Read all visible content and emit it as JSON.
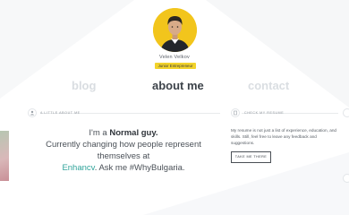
{
  "profile": {
    "name": "Velen Velkov",
    "tagline": "Junior Entrepreneur"
  },
  "nav": {
    "blog": "blog",
    "about": "about me",
    "contact": "contact"
  },
  "sections": {
    "about_label": "A LITTLE ABOUT ME",
    "resume_label": "CHECK MY RESUME"
  },
  "about": {
    "intro": "I'm a",
    "highlight": "Normal guy.",
    "line2": "Currently changing how people represent themselves at",
    "brand": "Enhancv",
    "line3": ". Ask me #WhyBulgaria."
  },
  "resume": {
    "text": "My resume is not just a list of experience, education, and skills. Still, feel free to leave any feedback and suggestions.",
    "button": "TAKE ME THERE"
  },
  "colors": {
    "accent_yellow": "#f2c51c",
    "brand_teal": "#2fa39a",
    "nav_active": "#3d434a",
    "nav_inactive": "#d9dde1"
  }
}
